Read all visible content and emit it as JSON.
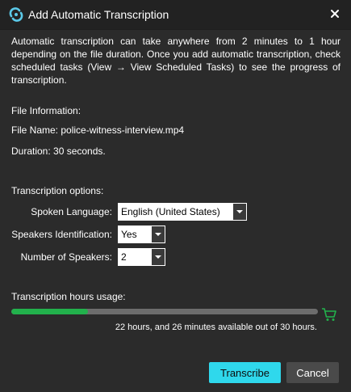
{
  "window": {
    "title": "Add Automatic Transcription",
    "app_icon": "app-logo-icon",
    "close_icon": "close-icon"
  },
  "intro_text": "Automatic transcription can take anywhere from 2 minutes to 1 hour depending on the file duration. Once you add automatic transcription, check scheduled tasks (View → View Scheduled Tasks) to see the progress of transcription.",
  "file_info": {
    "heading": "File Information:",
    "file_name": "File Name: police-witness-interview.mp4",
    "duration": "Duration: 30 seconds."
  },
  "options": {
    "heading": "Transcription options:",
    "spoken_language_label": "Spoken Language:",
    "spoken_language_value": "English (United States)",
    "speakers_identification_label": "Speakers Identification:",
    "speakers_identification_value": "Yes",
    "number_of_speakers_label": "Number of Speakers:",
    "number_of_speakers_value": "2"
  },
  "usage": {
    "heading": "Transcription hours usage:",
    "progress_fraction": 0.25,
    "summary": "22 hours, and 26 minutes available out of 30 hours.",
    "cart_icon": "shopping-cart-icon"
  },
  "buttons": {
    "transcribe": "Transcribe",
    "cancel": "Cancel"
  },
  "colors": {
    "accent": "#2fd8ec",
    "progress": "#22b14c",
    "background": "#2b2b2b",
    "titlebar": "#222222"
  }
}
